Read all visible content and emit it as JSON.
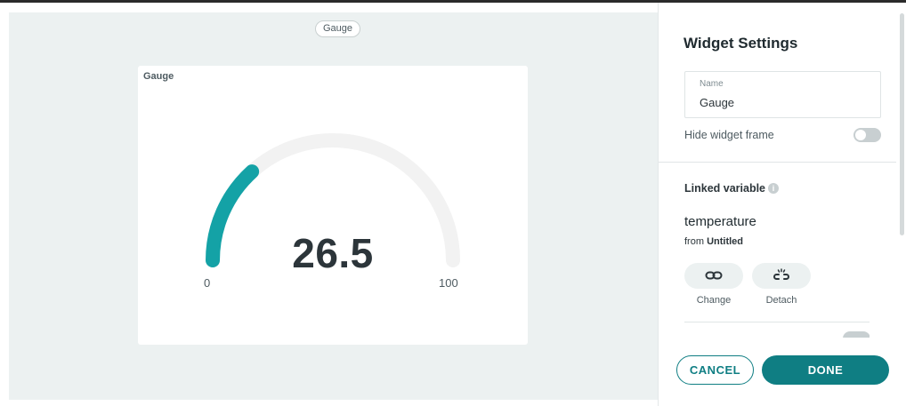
{
  "canvas": {
    "chip_label": "Gauge",
    "widget": {
      "title": "Gauge",
      "value": 26.5,
      "value_text": "26.5",
      "min": 0,
      "max": 100,
      "min_label": "0",
      "max_label": "100",
      "colors": {
        "track": "#f2f2f2",
        "fill": "#14a2a6"
      }
    }
  },
  "panel": {
    "title": "Widget Settings",
    "name_field": {
      "label": "Name",
      "value": "Gauge"
    },
    "hide_frame": {
      "label": "Hide widget frame",
      "enabled": false
    },
    "linked_variable": {
      "section_title": "Linked variable",
      "info_icon": "i",
      "variable_name": "temperature",
      "from_prefix": "from",
      "from_thing": "Untitled",
      "change_label": "Change",
      "change_icon": "link-icon",
      "detach_label": "Detach",
      "detach_icon": "unlink-icon"
    },
    "footer": {
      "cancel_label": "CANCEL",
      "done_label": "DONE"
    },
    "accent_color": "#0f7e83"
  }
}
